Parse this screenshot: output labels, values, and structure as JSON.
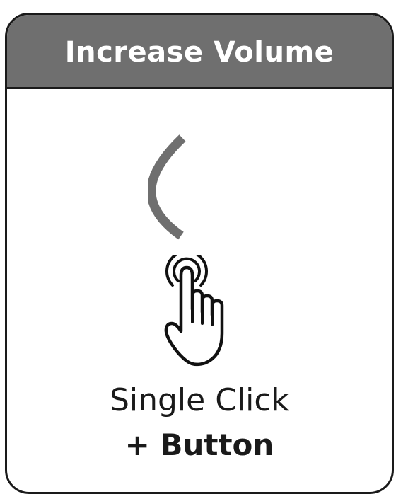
{
  "card": {
    "title": "Increase Volume",
    "instruction_primary": "Single Click",
    "instruction_secondary": "+ Button"
  },
  "icons": {
    "gesture": "single-tap-hand-icon",
    "volume": "volume-arc-icon"
  },
  "colors": {
    "header_background": "#6f6f6f",
    "header_text": "#ffffff",
    "arc": "#6f6f6f",
    "outline": "#1a1a1a",
    "background": "#ffffff"
  }
}
